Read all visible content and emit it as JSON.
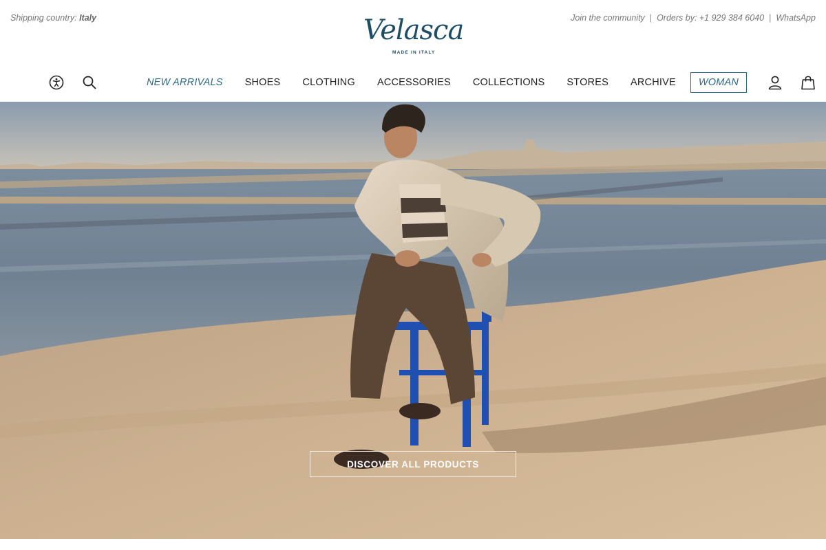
{
  "topbar": {
    "shipping_label": "Shipping country:",
    "shipping_country": "Italy",
    "links": {
      "community": "Join the community",
      "orders": "Orders by: +1 929 384 6040",
      "whatsapp": "WhatsApp",
      "separator": "|"
    }
  },
  "logo": {
    "wordmark": "Velasca",
    "tagline": "MADE IN ITALY",
    "color": "#1e4e66"
  },
  "nav": {
    "left_icons": [
      "accessibility-icon",
      "search-icon"
    ],
    "items": [
      {
        "label": "NEW ARRIVALS"
      },
      {
        "label": "SHOES"
      },
      {
        "label": "CLOTHING"
      },
      {
        "label": "ACCESSORIES"
      },
      {
        "label": "COLLECTIONS"
      },
      {
        "label": "STORES"
      },
      {
        "label": "ARCHIVE"
      },
      {
        "label": "WOMAN"
      }
    ],
    "right_icons": [
      "account-icon",
      "shopping-bag-icon"
    ],
    "accent_color": "#2f6a86"
  },
  "hero": {
    "cta_label": "DISCOVER ALL PRODUCTS"
  }
}
